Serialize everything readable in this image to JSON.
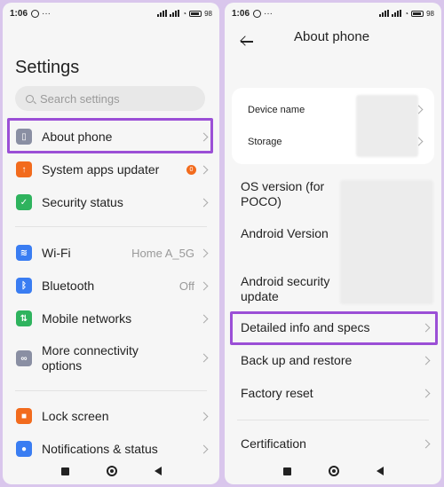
{
  "left": {
    "status": {
      "time": "1:06",
      "battery": "98"
    },
    "title": "Settings",
    "search": {
      "placeholder": "Search settings"
    },
    "items": [
      {
        "label": "About phone",
        "icon": "phone-icon",
        "color": "#8a8fa3"
      },
      {
        "label": "System apps updater",
        "icon": "arrow-up-icon",
        "color": "#f26b1d",
        "badge": "0"
      },
      {
        "label": "Security status",
        "icon": "shield-icon",
        "color": "#2fb35e"
      },
      {
        "label": "Wi-Fi",
        "icon": "wifi-icon",
        "color": "#3a7df2",
        "value": "Home A_5G"
      },
      {
        "label": "Bluetooth",
        "icon": "bluetooth-icon",
        "color": "#3a7df2",
        "value": "Off"
      },
      {
        "label": "Mobile networks",
        "icon": "signal-icon",
        "color": "#2fb35e"
      },
      {
        "label": "More connectivity options",
        "icon": "link-icon",
        "color": "#8a8fa3"
      },
      {
        "label": "Lock screen",
        "icon": "lock-icon",
        "color": "#f26b1d"
      },
      {
        "label": "Notifications & status",
        "icon": "bell-icon",
        "color": "#3a7df2"
      }
    ]
  },
  "right": {
    "status": {
      "time": "1:06",
      "battery": "98"
    },
    "title": "About phone",
    "card_items": [
      {
        "label": "Device name"
      },
      {
        "label": "Storage"
      }
    ],
    "items": [
      {
        "label": "OS version (for POCO)"
      },
      {
        "label": "Android Version"
      },
      {
        "label": "Android security update"
      },
      {
        "label": "Detailed info and specs"
      },
      {
        "label": "Back up and restore"
      },
      {
        "label": "Factory reset"
      },
      {
        "label": "Certification"
      }
    ]
  },
  "colors": {
    "highlight": "#9b4fd6",
    "background": "#f6f6f6"
  }
}
